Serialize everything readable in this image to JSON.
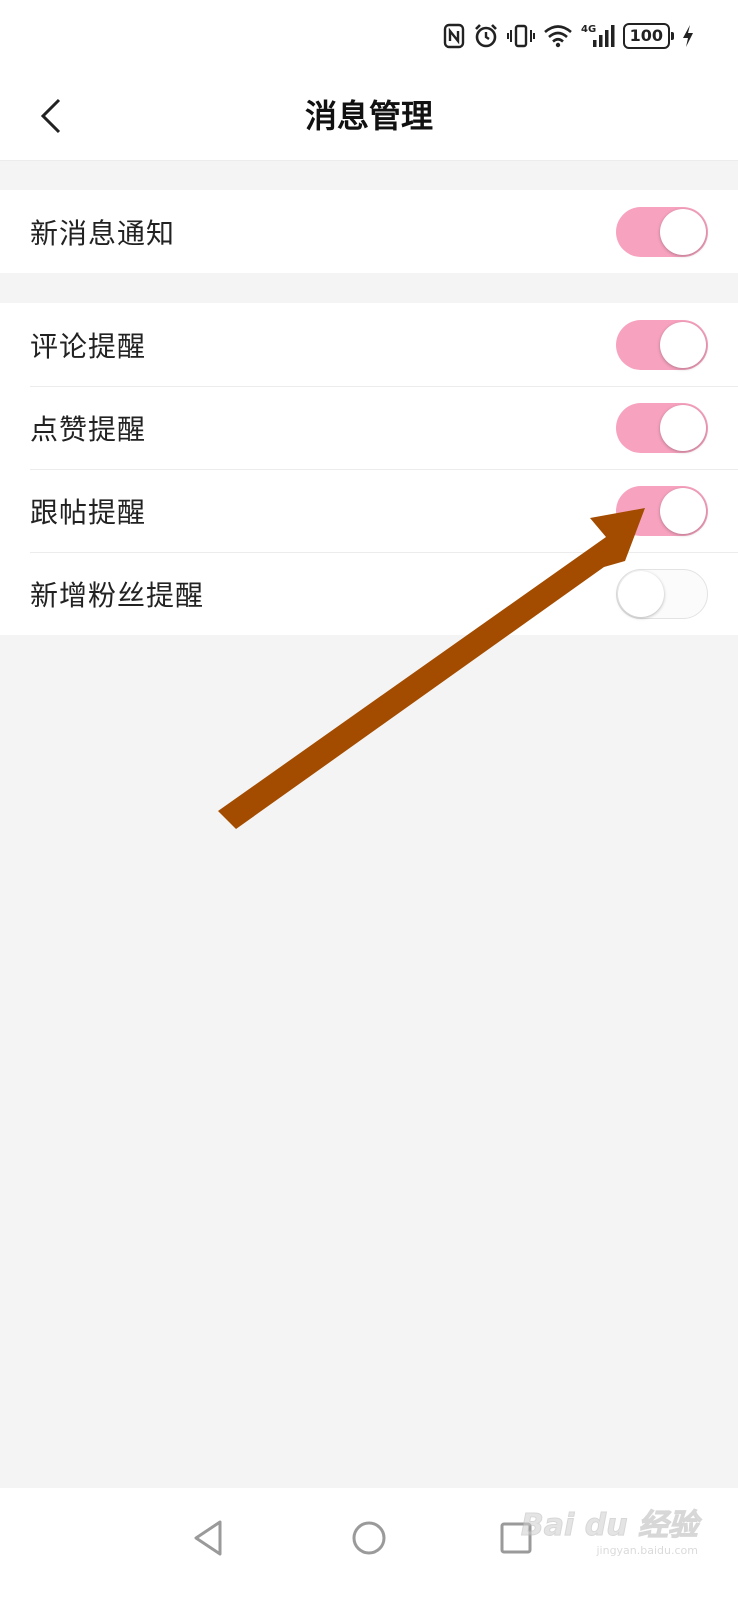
{
  "status_bar": {
    "battery_level": "100",
    "network_label": "4G"
  },
  "header": {
    "title": "消息管理"
  },
  "sections": {
    "master": [
      {
        "label": "新消息通知",
        "enabled": true
      }
    ],
    "notifications": [
      {
        "label": "评论提醒",
        "enabled": true
      },
      {
        "label": "点赞提醒",
        "enabled": true
      },
      {
        "label": "跟帖提醒",
        "enabled": true
      },
      {
        "label": "新增粉丝提醒",
        "enabled": false
      }
    ]
  },
  "watermark": {
    "logo": "Bai du 经验",
    "url": "jingyan.baidu.com"
  },
  "colors": {
    "toggle_on": "#f7a2bf",
    "toggle_off": "#fbfbfb",
    "arrow": "#a34c00",
    "background": "#f4f4f4"
  }
}
